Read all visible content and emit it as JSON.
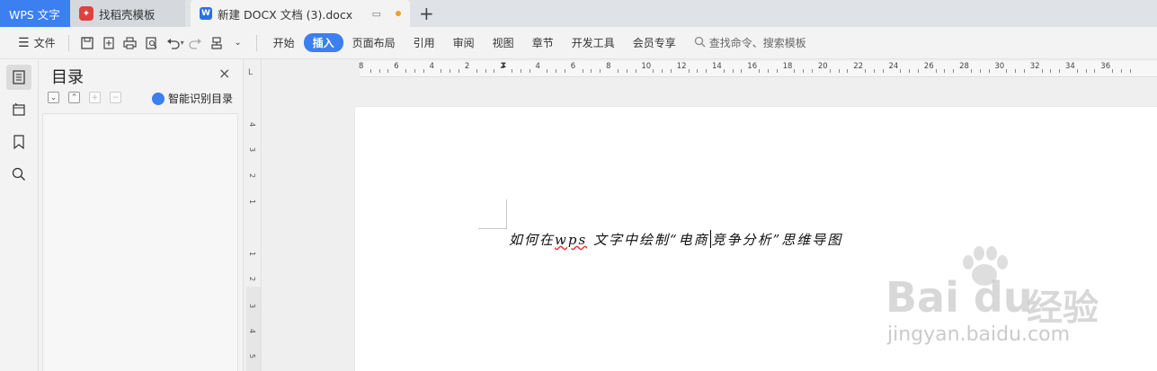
{
  "tabs": {
    "app_label": "WPS 文字",
    "tab2_label": "找稻壳模板",
    "tab3_label": "新建 DOCX 文档 (3).docx"
  },
  "toolbar": {
    "file_label": "文件",
    "menus": [
      "开始",
      "插入",
      "页面布局",
      "引用",
      "审阅",
      "视图",
      "章节",
      "开发工具",
      "会员专享"
    ],
    "active_menu": "插入",
    "search_placeholder": "查找命令、搜索模板"
  },
  "toc": {
    "title": "目录",
    "close": "×",
    "smart_label": "智能识别目录"
  },
  "ruler": {
    "corner": "L",
    "h_labels": [
      "8",
      "6",
      "4",
      "2",
      "2",
      "4",
      "6",
      "8",
      "10",
      "12",
      "14",
      "16",
      "18",
      "20",
      "22",
      "24",
      "26",
      "28",
      "30",
      "32",
      "34",
      "36"
    ],
    "v_labels": [
      "4",
      "3",
      "2",
      "1",
      "1",
      "2",
      "3",
      "4",
      "5"
    ]
  },
  "document": {
    "before_wps": "如何在",
    "wps": "wps",
    "after_wps_before_cursor": "文字中绘制“电商",
    "after_cursor": "竞争分析”思维导图"
  },
  "watermark": {
    "brand": "Bai du",
    "brand_cn": "经验",
    "url": "jingyan.baidu.com"
  },
  "colors": {
    "accent": "#3b7ff0",
    "modified_dot": "#f0a020"
  }
}
